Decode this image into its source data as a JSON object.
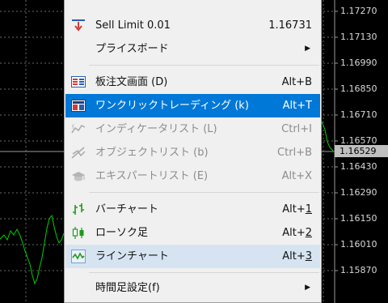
{
  "price_axis": {
    "labels": [
      "1.17270",
      "1.17130",
      "1.16990",
      "1.16850",
      "1.16710",
      "1.16570",
      "1.16430",
      "1.16290",
      "1.16150",
      "1.16010",
      "1.15870"
    ],
    "current": "1.16529"
  },
  "menu": {
    "items": [
      {
        "label": "Sell Limit 0.01",
        "shortcut": "1.16731",
        "icon": "sell-limit-icon"
      },
      {
        "label": "プライスボード",
        "shortcut": "",
        "icon": "",
        "submenu": true
      },
      {
        "label": "板注文画面 (D)",
        "shortcut": "Alt+B",
        "icon": "order-book-icon"
      },
      {
        "label": "ワンクリックトレーディング (k)",
        "shortcut": "Alt+T",
        "icon": "one-click-trading-icon",
        "highlighted": true
      },
      {
        "label": "インディケータリスト (L)",
        "shortcut": "Ctrl+I",
        "icon": "indicator-list-icon",
        "disabled": true
      },
      {
        "label": "オブジェクトリスト (b)",
        "shortcut": "Ctrl+B",
        "icon": "object-list-icon",
        "disabled": true
      },
      {
        "label": "エキスパートリスト (E)",
        "shortcut": "Alt+X",
        "icon": "expert-list-icon",
        "disabled": true
      },
      {
        "label": "バーチャート",
        "shortcut": "Alt+1",
        "icon": "bar-chart-icon"
      },
      {
        "label": "ローソク足",
        "shortcut": "Alt+2",
        "icon": "candlestick-icon"
      },
      {
        "label": "ラインチャート",
        "shortcut": "Alt+3",
        "icon": "line-chart-icon"
      },
      {
        "label": "時間足設定(f)",
        "shortcut": "",
        "icon": "",
        "submenu": true
      }
    ]
  },
  "colors": {
    "highlight": "#0078d7",
    "chart_line": "#00d000",
    "menu_bg": "#f0f0f0"
  }
}
